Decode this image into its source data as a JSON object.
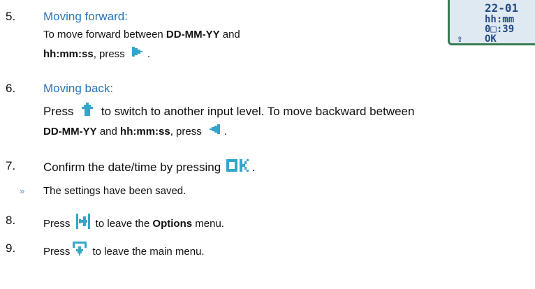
{
  "steps": [
    {
      "num": "5.",
      "heading": "Moving forward:",
      "line1_pre": "To move forward between ",
      "line1_b": "DD-MM-YY",
      "line1_post": " and",
      "line2_b": "hh:mm:ss",
      "line2_post": ", press "
    },
    {
      "num": "6.",
      "heading": "Moving back:",
      "line1_pre": "Press ",
      "line1_post": " to switch to another input level. To move backward between",
      "line2_b1": "DD-MM-YY",
      "line2_mid": " and ",
      "line2_b2": "hh:mm:ss",
      "line2_post": ", press "
    },
    {
      "num": "7.",
      "text": "Confirm the date/time by pressing "
    },
    {
      "num": "»",
      "text": "The settings have been saved."
    },
    {
      "num": "8.",
      "pre": "Press ",
      "post_pre": " to leave the ",
      "bold": "Options",
      "post": " menu."
    },
    {
      "num": "9.",
      "pre": "Press",
      "post": " to leave the main menu."
    }
  ],
  "lcd": {
    "line1": "22-01",
    "line2": "hh:mm",
    "line3": "0□:39",
    "soft_left": "⇧",
    "soft_ok": "OK"
  },
  "icons": {
    "right": "arrow-right-icon",
    "up": "arrow-up-icon",
    "left": "arrow-left-icon",
    "ok": "ok-icon",
    "exit_menu": "exit-menu-icon",
    "exit_main": "exit-main-icon"
  },
  "colors": {
    "heading": "#2a73b8",
    "icon": "#35a6c9",
    "lcd_bg": "#dfe9f1",
    "lcd_text": "#244a84",
    "lcd_border": "#3a7b52"
  }
}
